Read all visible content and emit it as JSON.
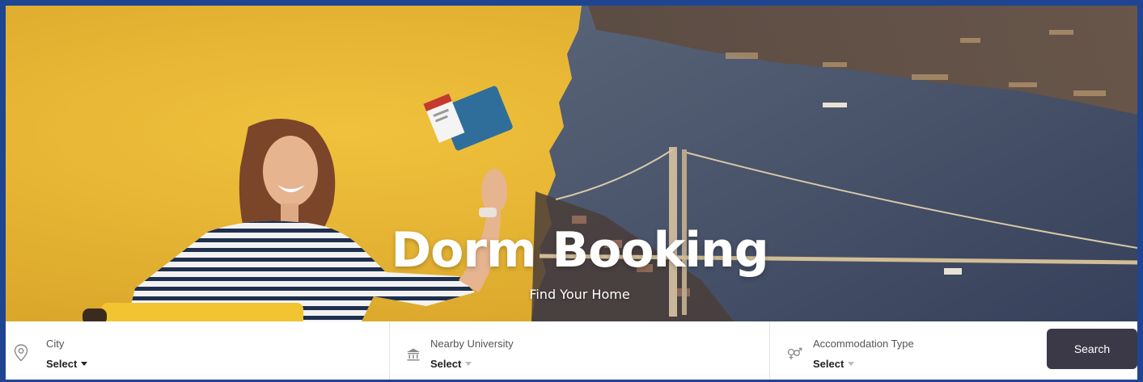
{
  "hero": {
    "title": "Dorm Booking",
    "subtitle": "Find Your Home",
    "colors": {
      "yellow": "#e6b431",
      "water": "#3f4a63",
      "border": "#1f4592"
    }
  },
  "search": {
    "city": {
      "label": "City",
      "value": "Select",
      "icon": "map-pin-icon"
    },
    "university": {
      "label": "Nearby University",
      "value": "Select",
      "icon": "university-icon"
    },
    "accommodation": {
      "label": "Accommodation Type",
      "value": "Select",
      "icon": "gender-icon"
    },
    "button_label": "Search",
    "button_color": "#3b3848"
  }
}
